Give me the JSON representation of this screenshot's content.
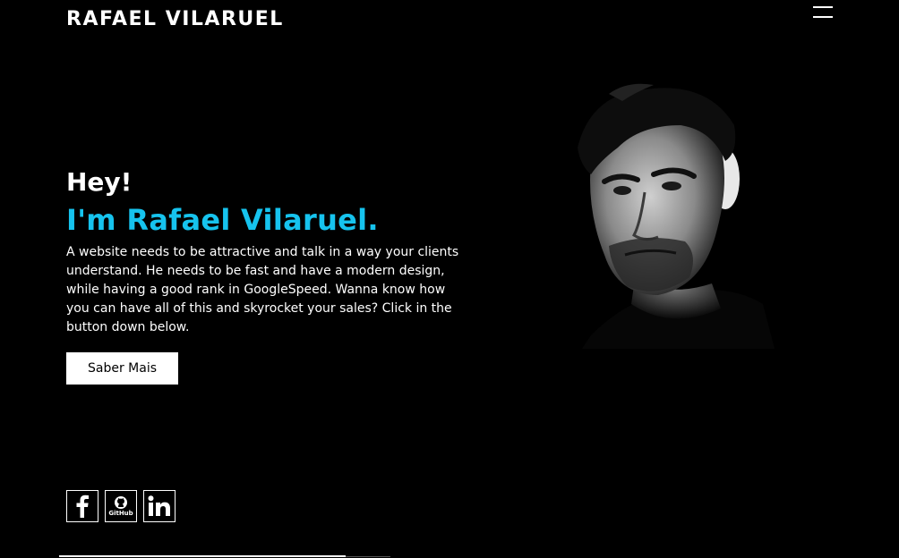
{
  "header": {
    "logo": "RAFAEL VILARUEL",
    "menu_icon": "hamburger-icon"
  },
  "hero": {
    "greeting": "Hey!",
    "title": "I'm Rafael Vilaruel.",
    "description": "A website needs to be attractive and talk in a way your clients understand. He needs to be fast and have a modern design, while having a good rank in GoogleSpeed. Wanna know how you can have all of this and skyrocket your sales? Click in the button down below.",
    "cta_label": "Saber Mais",
    "accent_color": "#16c3ee"
  },
  "socials": [
    {
      "name": "facebook",
      "icon": "facebook-icon"
    },
    {
      "name": "github",
      "icon": "github-icon",
      "label": "GitHub"
    },
    {
      "name": "linkedin",
      "icon": "linkedin-icon"
    }
  ]
}
